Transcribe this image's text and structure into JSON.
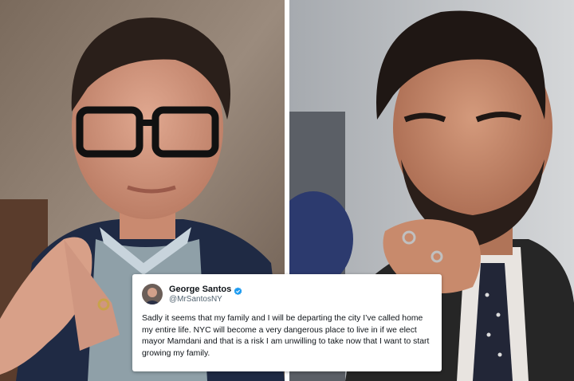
{
  "tweet": {
    "author_name": "George Santos",
    "author_handle": "@MrSantosNY",
    "text": "Sadly it seems that my family and I will be departing the city I’ve called home my entire life. NYC will become a very dangerous place to live in if we elect mayor Mamdani and that is a risk I am unwilling to take now that I want to start growing my family.",
    "verified_icon": "verified-badge-icon",
    "verified_color": "#1d9bf0"
  },
  "photos": {
    "left": "photo of man with glasses and fingers steepled",
    "right": "photo of bearded man with hand on chin"
  }
}
